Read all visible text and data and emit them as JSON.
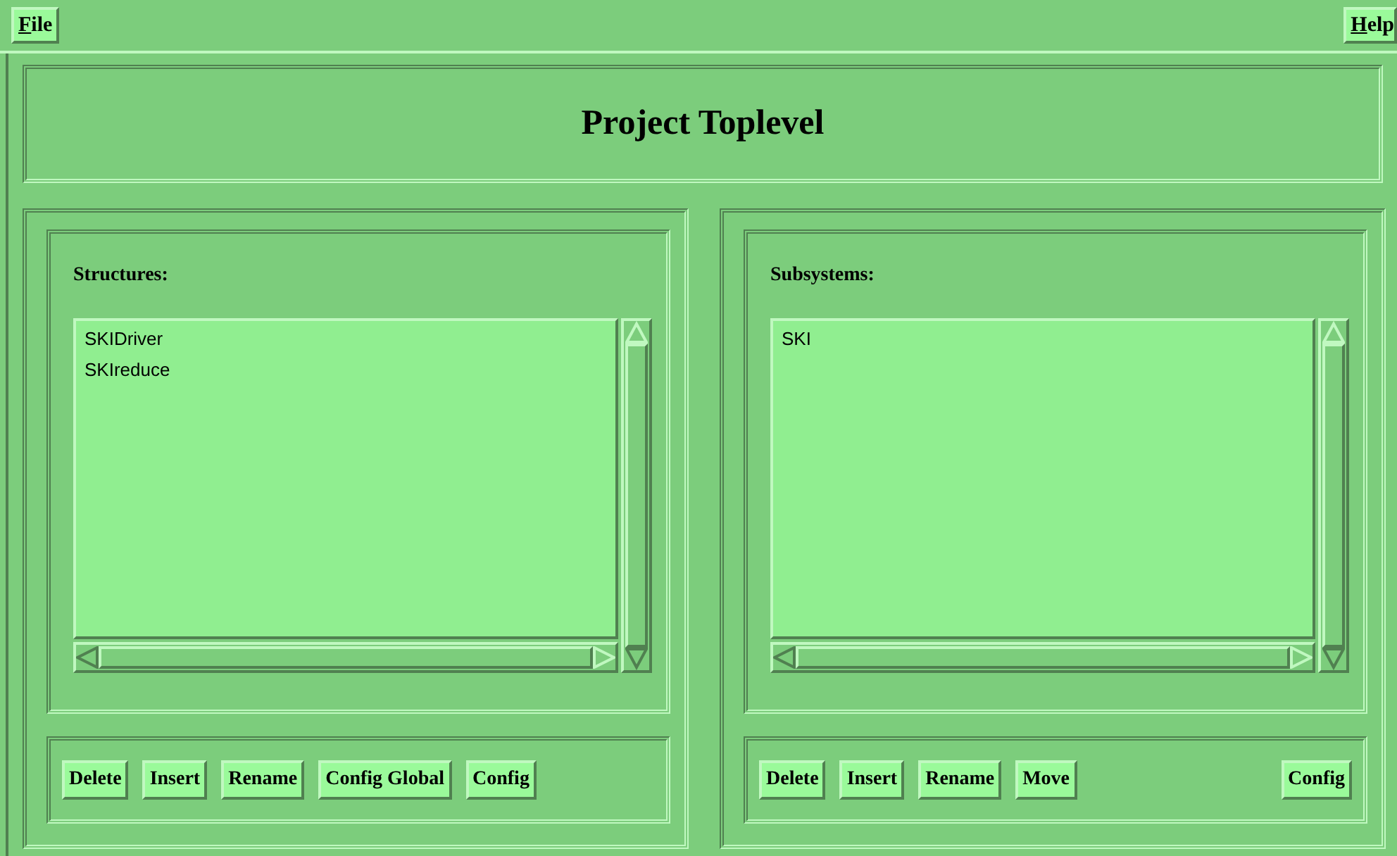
{
  "menubar": {
    "left": [
      {
        "label": "File"
      }
    ],
    "right": [
      {
        "label": "Help"
      }
    ]
  },
  "title": "Project Toplevel",
  "panels": [
    {
      "label": "Structures:",
      "items": [
        "SKIDriver",
        "SKIreduce"
      ],
      "buttons": [
        "Delete",
        "Insert",
        "Rename",
        "Config Global",
        "Config"
      ]
    },
    {
      "label": "Subsystems:",
      "items": [
        "SKI"
      ],
      "buttons": [
        "Delete",
        "Insert",
        "Rename",
        "Move"
      ],
      "right_buttons": [
        "Config"
      ]
    }
  ]
}
